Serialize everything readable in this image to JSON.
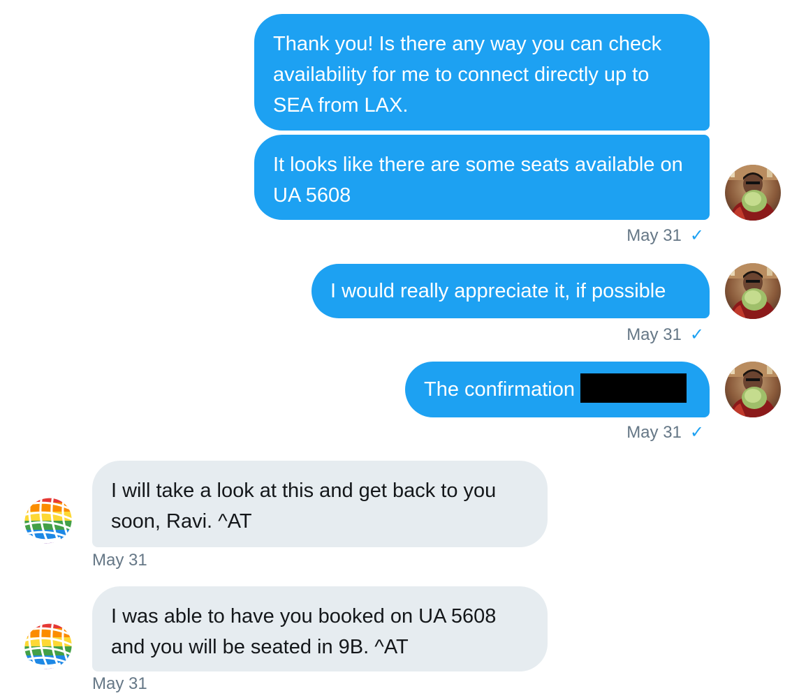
{
  "conversation": {
    "messages": [
      {
        "direction": "outgoing",
        "text": "Thank you! Is there any way you can check availability for me to connect directly up to SEA from LAX."
      },
      {
        "direction": "outgoing",
        "text": "It looks like there are some seats available on UA 5608",
        "timestamp": "May 31",
        "read_icon": "checkmark-icon"
      },
      {
        "direction": "outgoing",
        "text": "I would really appreciate it, if possible",
        "timestamp": "May 31",
        "read_icon": "checkmark-icon"
      },
      {
        "direction": "outgoing",
        "text": "The confirmation",
        "redacted": true,
        "timestamp": "May 31",
        "read_icon": "checkmark-icon"
      },
      {
        "direction": "incoming",
        "text": "I will take a look at this and get back to you soon, Ravi. ^AT",
        "timestamp": "May 31"
      },
      {
        "direction": "incoming",
        "text": "I was able to have you booked on UA 5608 and you will be seated in 9B. ^AT",
        "timestamp": "May 31"
      }
    ],
    "check_glyph": "✓"
  },
  "colors": {
    "outgoing_bubble": "#1da1f2",
    "incoming_bubble": "#e6ecf0",
    "timestamp": "#657786",
    "check": "#1da1f2"
  },
  "avatars": {
    "user": "user-photo-avatar",
    "airline": "airline-globe-logo-avatar"
  }
}
